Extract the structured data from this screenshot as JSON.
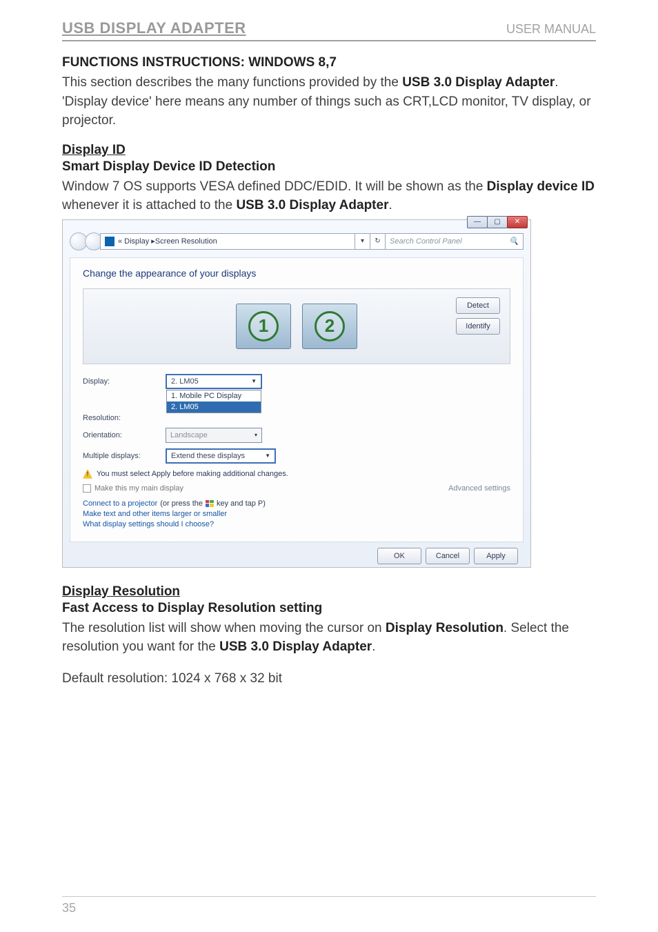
{
  "header": {
    "left": "USB DISPLAY ADAPTER",
    "right": "USER MANUAL"
  },
  "doc": {
    "h1": "FUNCTIONS INSTRUCTIONS: WINDOWS 8,7",
    "p1_a": "This section describes the many functions provided by the ",
    "p1_bold1": "USB 3.0 Display Adapter",
    "p1_b": ". 'Display device' here means any number of things such as CRT,LCD monitor, TV display, or projector.",
    "h2": "Display ID",
    "h3": "Smart Display Device ID Detection",
    "p2_a": "Window 7 OS supports VESA defined DDC/EDID. It will be shown as the ",
    "p2_bold1": "Display device ID",
    "p2_b": " whenever it is attached to the ",
    "p2_bold2": "USB 3.0 Display Adapter",
    "p2_c": ".",
    "h4": "Display Resolution",
    "h5": "Fast Access to Display Resolution setting",
    "p3_a": "The resolution list will show when moving the cursor on ",
    "p3_bold1": "Display Resolution",
    "p3_b": ". Select the resolution you want for the ",
    "p3_bold2": "USB 3.0 Display Adapter",
    "p3_c": ".",
    "p4": "Default resolution: 1024 x 768 x 32 bit"
  },
  "shot": {
    "breadcrumb_prefix": "«  Display  ▸  ",
    "breadcrumb_current": "Screen Resolution",
    "search_placeholder": "Search Control Panel",
    "title": "Change the appearance of your displays",
    "buttons": {
      "detect": "Detect",
      "identify": "Identify",
      "ok": "OK",
      "cancel": "Cancel",
      "apply": "Apply"
    },
    "monitors": {
      "one": "1",
      "two": "2"
    },
    "labels": {
      "display": "Display:",
      "resolution": "Resolution:",
      "orientation": "Orientation:",
      "multiple": "Multiple displays:"
    },
    "values": {
      "display_selected": "2. LM05",
      "display_options": [
        "1. Mobile PC Display",
        "2. LM05"
      ],
      "orientation": "Landscape",
      "multiple": "Extend these displays"
    },
    "warn": "You must select Apply before making additional changes.",
    "maindisplay_label": "Make this my main display",
    "adv_link": "Advanced settings",
    "link1_a": "Connect to a projector",
    "link1_b": " (or press the ",
    "link1_c": " key and tap P)",
    "link2": "Make text and other items larger or smaller",
    "link3": "What display settings should I choose?"
  },
  "page_number": "35"
}
